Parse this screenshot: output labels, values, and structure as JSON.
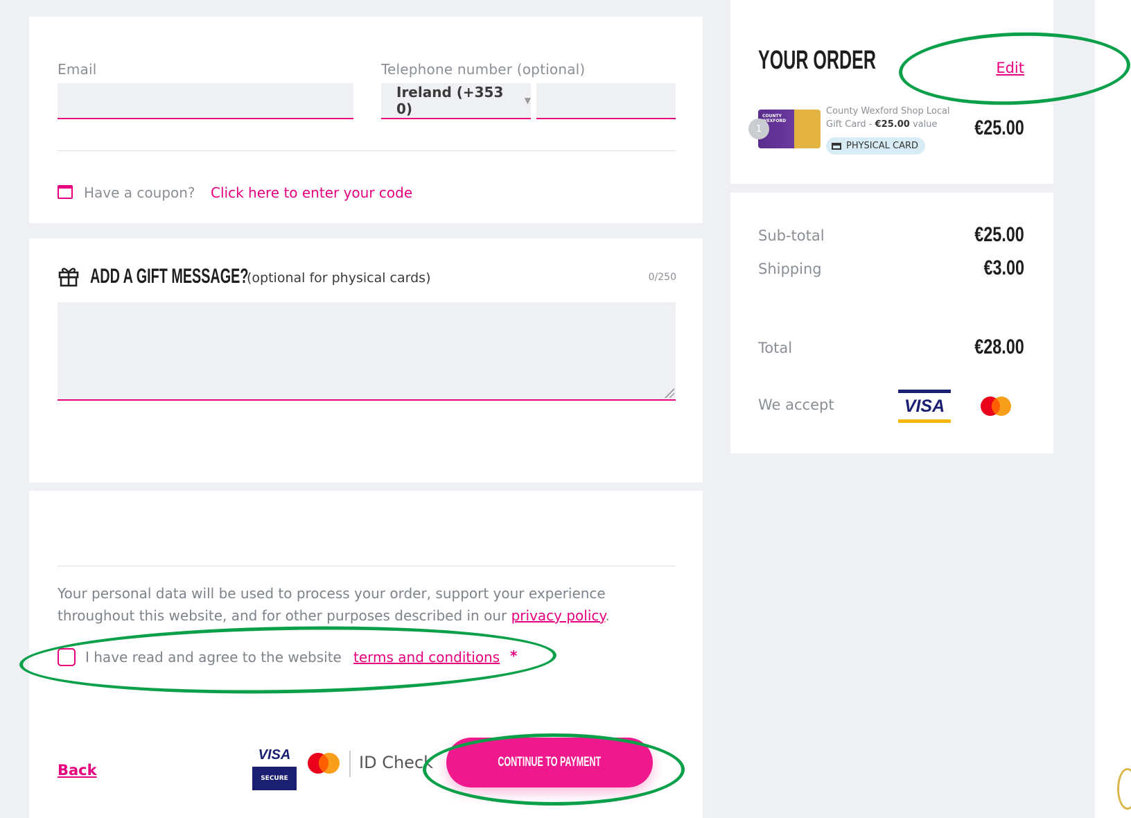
{
  "form": {
    "email_label": "Email",
    "email_value": "",
    "phone_label": "Telephone number (optional)",
    "country_select": "Ireland (+353 0)",
    "phone_value": "",
    "coupon_prompt": "Have a coupon?",
    "coupon_link": "Click here to enter your code"
  },
  "gift": {
    "heading": "ADD A GIFT MESSAGE?",
    "subheading": "(optional for physical cards)",
    "counter": "0/250",
    "message_value": ""
  },
  "privacy": {
    "text": "Your personal data will be used to process your order, support your experience throughout this website, and for other purposes described in our",
    "link": "privacy policy",
    "period": "."
  },
  "terms": {
    "text": "I have read and agree to the website",
    "link": "terms and conditions",
    "required_mark": "*"
  },
  "footer": {
    "back_label": "Back",
    "visa_secure_top": "VISA",
    "visa_secure_bottom": "SECURE",
    "id_check_label": "ID Check",
    "continue_label": "CONTINUE TO PAYMENT"
  },
  "order": {
    "title": "YOUR ORDER",
    "edit_label": "Edit",
    "item_qty": "1",
    "item_name": "County Wexford Shop Local Gift Card - ",
    "item_value": "€25.00",
    "item_value_suffix": " value",
    "item_badge": "PHYSICAL CARD",
    "item_price": "€25.00",
    "card_image_text": "COUNTY WEXFORD"
  },
  "summary": {
    "subtotal_label": "Sub-total",
    "subtotal_value": "€25.00",
    "shipping_label": "Shipping",
    "shipping_value": "€3.00",
    "total_label": "Total",
    "total_value": "€28.00",
    "accept_label": "We accept",
    "visa_label": "VISA"
  },
  "colors": {
    "accent": "#e6007e",
    "annotation": "#0aa04a",
    "background": "#eef0f3"
  }
}
